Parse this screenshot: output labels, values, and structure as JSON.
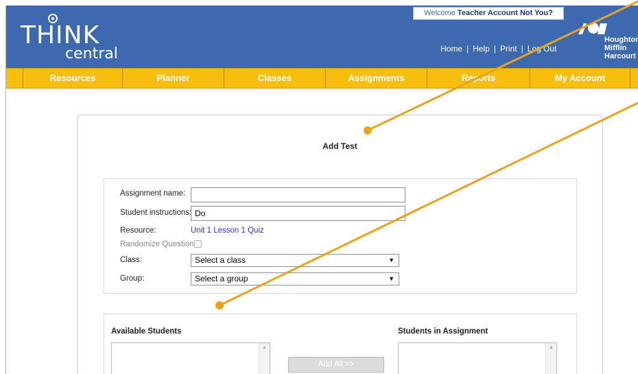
{
  "brand": {
    "logo_top": "THINK",
    "logo_bottom": "central"
  },
  "welcome": {
    "prefix": "Welcome ",
    "user": "Teacher Account",
    "not_you": "Not You?"
  },
  "top_links": [
    "Home",
    "Help",
    "Print",
    "Log Out"
  ],
  "publisher": {
    "line1": "Houghton",
    "line2": "Mifflin",
    "line3": "Harcourt"
  },
  "nav": [
    "Resources",
    "Planner",
    "Classes",
    "Assignments",
    "Reports",
    "My Account"
  ],
  "form": {
    "title": "Add Test",
    "assignment_name_label": "Assignment name:",
    "assignment_name_value": "",
    "instructions_label": "Student instructions:",
    "instructions_value": "Do",
    "resource_label": "Resource:",
    "resource_value": "Unit 1 Lesson 1 Quiz",
    "randomize_label": "Randomize Questions",
    "class_label": "Class:",
    "class_value": "Select a class",
    "group_label": "Group:",
    "group_value": "Select a group"
  },
  "students": {
    "available_label": "Available Students",
    "assigned_label": "Students in Assignment",
    "add_all_label": "Add All >>"
  },
  "colors": {
    "header": "#3d6aae",
    "nav": "#f6bf0e",
    "callout": "#e8a31a"
  }
}
